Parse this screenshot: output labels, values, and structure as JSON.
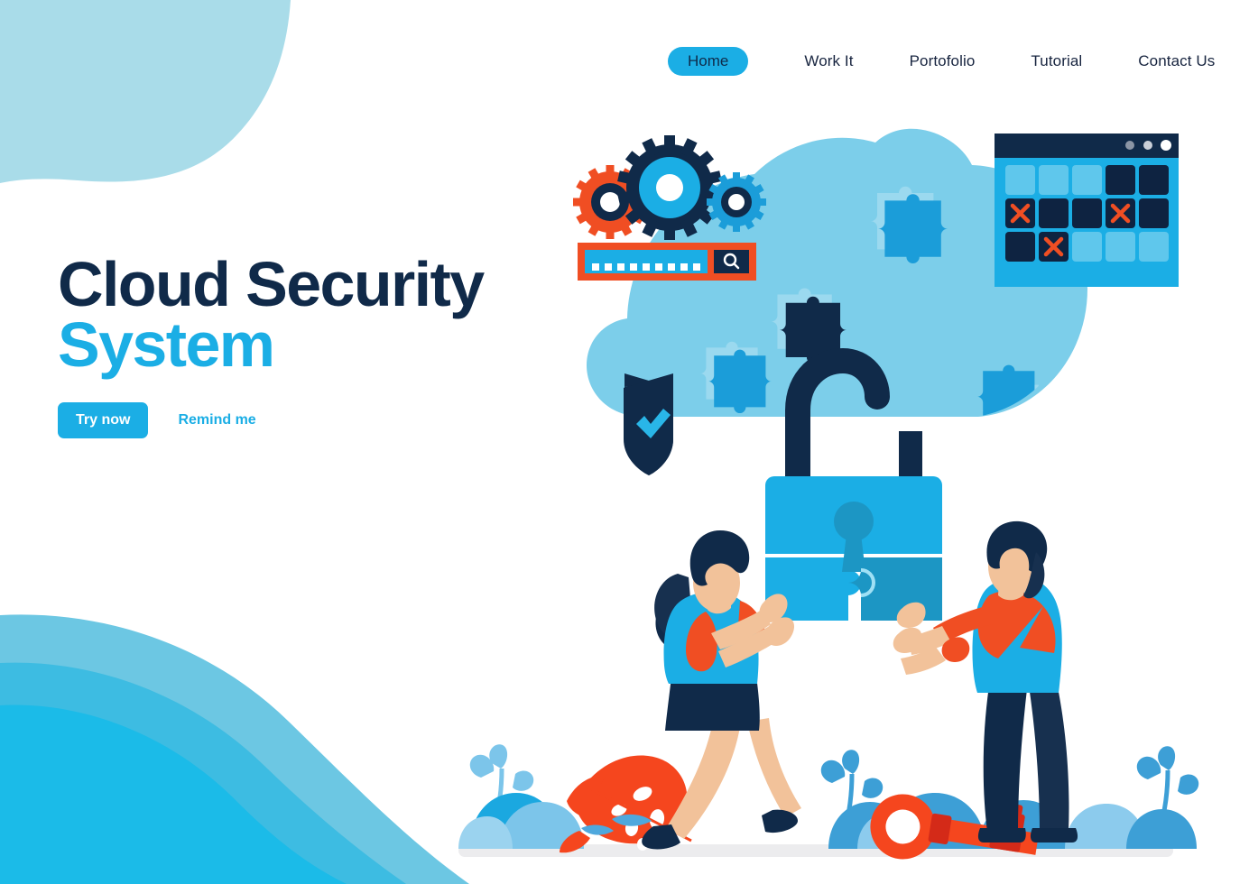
{
  "page": {
    "title": "Cloud Security System landing page",
    "background": "#ffffff"
  },
  "nav": {
    "items": [
      {
        "label": "Home",
        "active": true
      },
      {
        "label": "Work It",
        "active": false
      },
      {
        "label": "Portofolio",
        "active": false
      },
      {
        "label": "Tutorial",
        "active": false
      },
      {
        "label": "Contact Us",
        "active": false
      }
    ]
  },
  "hero": {
    "title_line1": "Cloud Security",
    "title_line2": "System",
    "primary_button": "Try now",
    "secondary_button": "Remind me"
  },
  "illustration": {
    "search_bar": {
      "dots": 9,
      "icon": "search-icon"
    },
    "gears": [
      {
        "name": "gear-small-orange",
        "ring": "#F04E23",
        "hub": "#102a49"
      },
      {
        "name": "gear-large-navy",
        "ring": "#102a49",
        "hub": "#1BAEE5"
      },
      {
        "name": "gear-medium-blue",
        "ring": "#1B9DD9",
        "hub": "#102a49"
      }
    ],
    "browser_window": {
      "dots": [
        "#8b95a5",
        "#c9cfd8",
        "#ffffff"
      ],
      "grid_rows": [
        [
          "light",
          "light",
          "light",
          "dark",
          "dark"
        ],
        [
          "dark-x",
          "dark",
          "dark",
          "dark-x",
          "dark"
        ],
        [
          "dark",
          "dark-x",
          "light",
          "light",
          "light"
        ]
      ]
    },
    "shield": {
      "name": "shield-check-icon",
      "body": "#102a49",
      "check": "#1BAEE5"
    },
    "padlock": {
      "name": "padlock-open-icon",
      "shackle": "#102a49",
      "body": "#1BAEE5"
    },
    "puzzle_pieces": 4,
    "characters": [
      {
        "name": "woman-character",
        "hair": "#102a49",
        "top": "#1BAEE5",
        "sleeves": "#F04E23",
        "skirt": "#102a49"
      },
      {
        "name": "man-character",
        "hair": "#102a49",
        "sweater": "#1BAEE5",
        "stripe": "#F04E23",
        "pants": "#102a49"
      }
    ],
    "key": {
      "name": "key-icon",
      "color": "#F5461E"
    }
  },
  "colors": {
    "brand_blue": "#1BAEE5",
    "navy": "#102a49",
    "orange": "#F04E23",
    "cloud": "#7CCEEA",
    "pale_cyan": "#A9DCE9",
    "ground": "#ECECEE"
  }
}
